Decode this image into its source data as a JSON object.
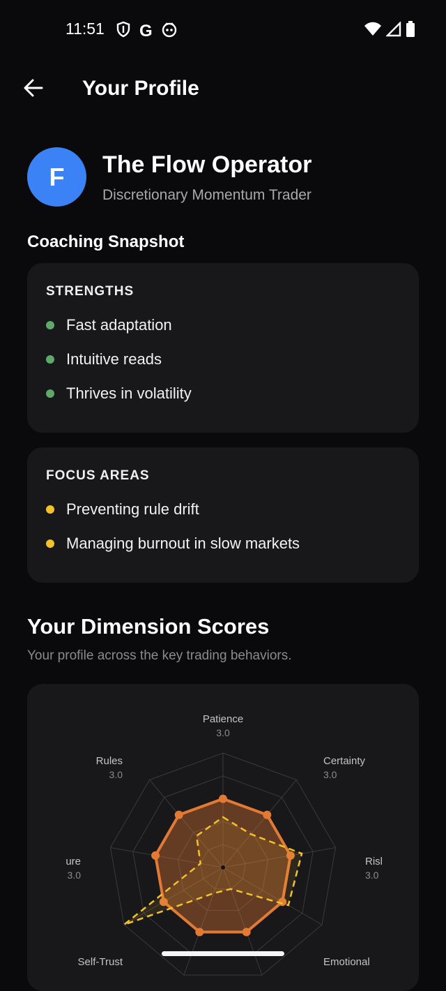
{
  "status_bar": {
    "time": "11:51"
  },
  "header": {
    "title": "Your Profile"
  },
  "profile": {
    "avatar_letter": "F",
    "name": "The Flow Operator",
    "subtitle": "Discretionary Momentum Trader",
    "avatar_color": "#3b82f6"
  },
  "snapshot": {
    "heading": "Coaching Snapshot",
    "strengths": {
      "label": "STRENGTHS",
      "items": [
        "Fast adaptation",
        "Intuitive reads",
        "Thrives in volatility"
      ]
    },
    "focus_areas": {
      "label": "FOCUS AREAS",
      "items": [
        "Preventing rule drift",
        "Managing burnout in slow markets"
      ]
    }
  },
  "dimensions": {
    "title": "Your Dimension Scores",
    "subtitle": "Your profile across the key trading behaviors.",
    "labels": {
      "patience": "Patience",
      "certainty": "Certainty",
      "risk": "Risl",
      "emotional": "Emotional",
      "self_trust": "Self-Trust",
      "pressure": "ure",
      "rules": "Rules"
    },
    "scores": {
      "patience": "3.0",
      "certainty": "3.0",
      "risk": "3.0",
      "pressure": "3.0",
      "rules": "3.0"
    }
  },
  "chart_data": {
    "type": "radar",
    "axes": [
      "Patience",
      "Certainty",
      "Risl",
      "",
      "Emotional",
      "",
      "Self-Trust",
      "ure",
      "Rules"
    ],
    "max": 5,
    "levels": 5,
    "series": [
      {
        "values": [
          3,
          3,
          3,
          3,
          3,
          3,
          3,
          3,
          3
        ],
        "color": "#e27a35",
        "style": "solid"
      },
      {
        "values": [
          2.2,
          1.9,
          3.5,
          3.3,
          1.0,
          1.2,
          5.0,
          1.0,
          1.8
        ],
        "color": "#f3c12b",
        "style": "dashed"
      }
    ]
  }
}
